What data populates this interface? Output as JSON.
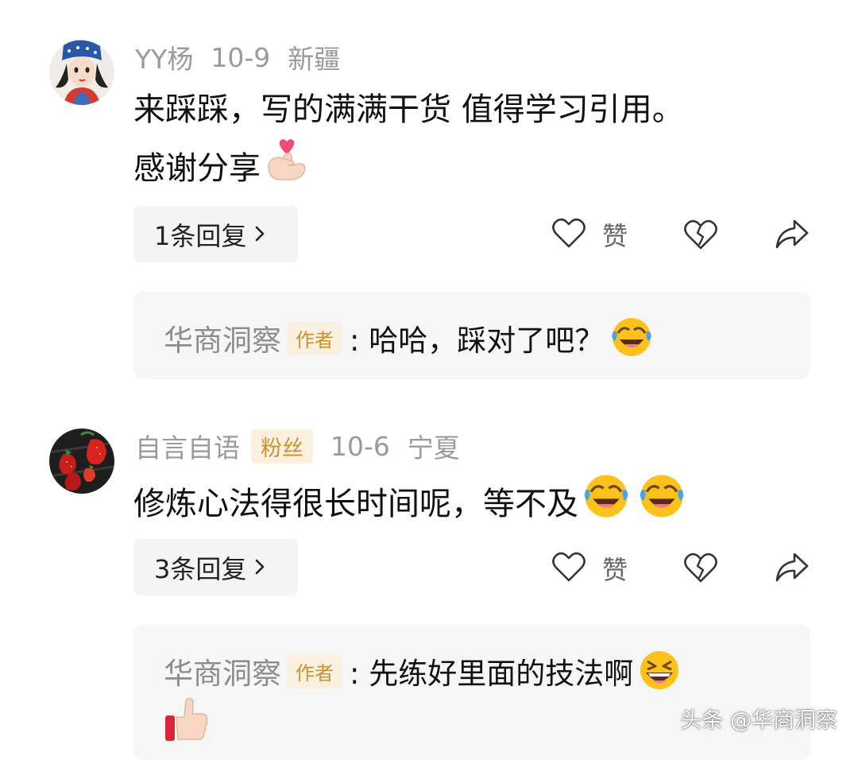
{
  "comments": [
    {
      "username": "YY杨",
      "date": "10-9",
      "location": "新疆",
      "badge": "",
      "content_line1": "来踩踩，写的满满干货 值得学习引用。",
      "content_line2": "感谢分享",
      "content_emoji": "finger-heart-emoji",
      "replies_label": "1条回复",
      "like_label": "赞",
      "reply": {
        "author": "华商洞察",
        "author_badge": "作者",
        "text": ": 哈哈，踩对了吧？",
        "emoji": "rolling-laughing-emoji"
      }
    },
    {
      "username": "自言自语",
      "badge": "粉丝",
      "date": "10-6",
      "location": "宁夏",
      "content_line1": "修炼心法得很长时间呢，等不及",
      "content_emoji": "rolling-laughing-emoji",
      "replies_label": "3条回复",
      "like_label": "赞",
      "reply": {
        "author": "华商洞察",
        "author_badge": "作者",
        "text": ": 先练好里面的技法啊",
        "emoji": "grinning-squinting-emoji",
        "emoji_line2": "thumbs-up-emoji"
      }
    }
  ],
  "watermark": "头条 @华商洞察",
  "colors": {
    "meta_gray": "#9a9a9a",
    "badge_bg": "#fbf0df",
    "badge_text": "#c8932e",
    "reply_bg": "#f6f6f6",
    "button_bg": "#f4f4f4"
  }
}
